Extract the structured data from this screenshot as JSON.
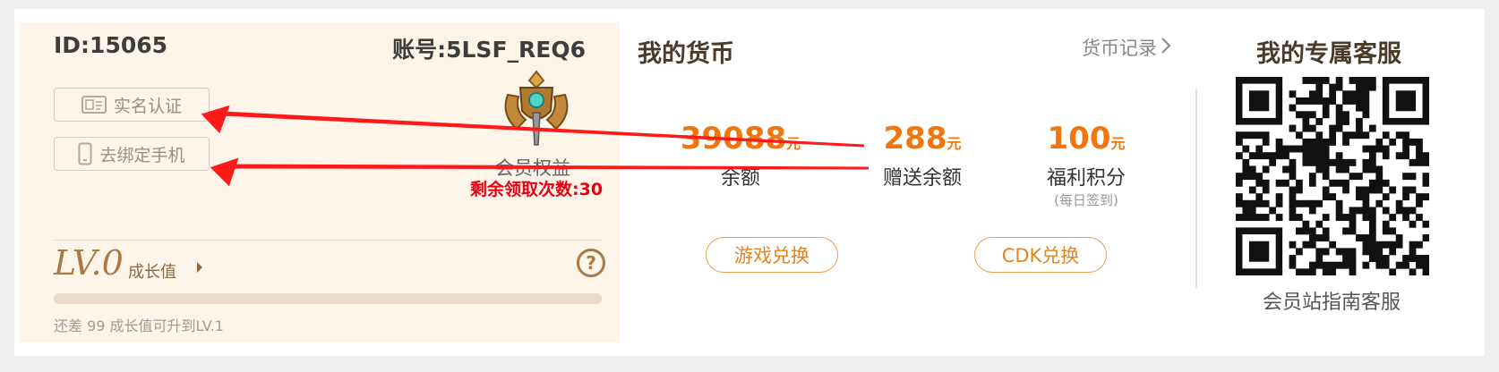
{
  "account": {
    "id_text": "ID:15065",
    "account_text": "账号:5LSF_REQ6"
  },
  "buttons": {
    "realname": "实名认证",
    "unbind_phone": "去绑定手机"
  },
  "membership": {
    "benefit_label": "会员权益",
    "remaining_claims": "剩余领取次数:30"
  },
  "level": {
    "value": "LV.0",
    "growth_label": "成长值",
    "progress_fraction": 0,
    "upgrade_tip": "还差 99 成长值可升到LV.1"
  },
  "currency": {
    "title": "我的货币",
    "record_link": "货币记录",
    "balance": {
      "value": "39088",
      "unit": "元",
      "label": "余额"
    },
    "gift_balance": {
      "value": "288",
      "unit": "元",
      "label": "赠送余额"
    },
    "points": {
      "value": "100",
      "unit": "元",
      "label": "福利积分",
      "sub": "(每日签到)"
    },
    "game_exchange": "游戏兑换",
    "cdk_exchange": "CDK兑换"
  },
  "service": {
    "title": "我的专属客服",
    "caption": "会员站指南客服"
  },
  "icons": {
    "id_card": "id-card-icon",
    "phone": "phone-icon",
    "medal": "medal-icon",
    "help": "help-icon",
    "arrow": "chevron-right-icon",
    "qr": "qr-code-icon"
  },
  "colors": {
    "accent": "#f0770f",
    "brand_gold": "#c6965a",
    "alert_red": "#e60012",
    "annotation_arrow": "#ff1a1a"
  }
}
